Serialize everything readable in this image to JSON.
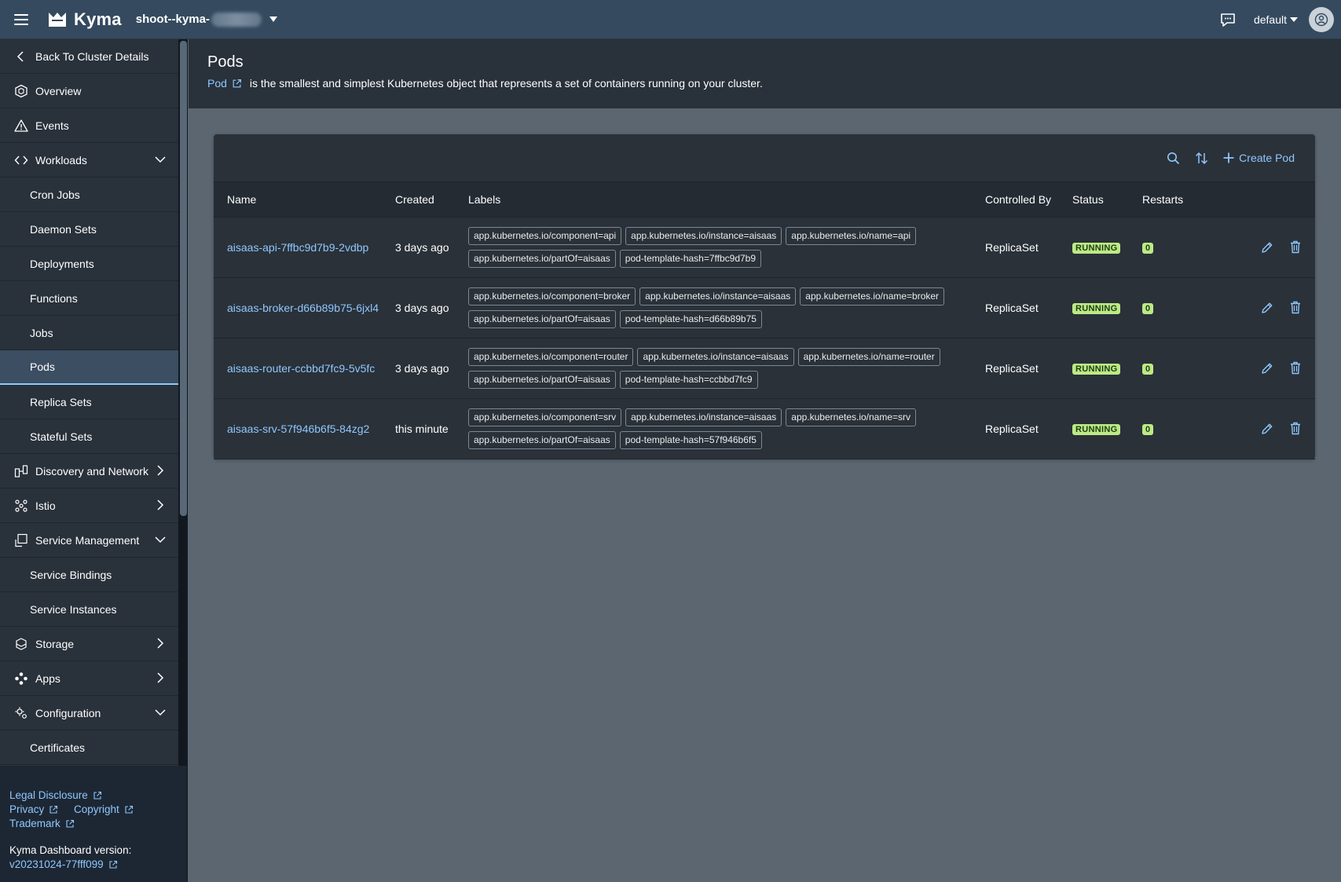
{
  "shell": {
    "app_name": "Kyma",
    "cluster_name": "shoot--kyma-",
    "namespace": "default"
  },
  "sidebar": {
    "back": "Back To Cluster Details",
    "items": [
      {
        "label": "Overview",
        "icon": "overview-icon"
      },
      {
        "label": "Events",
        "icon": "warning-icon"
      },
      {
        "label": "Workloads",
        "icon": "workloads-icon",
        "expanded": true
      },
      {
        "label": "Cron Jobs"
      },
      {
        "label": "Daemon Sets"
      },
      {
        "label": "Deployments"
      },
      {
        "label": "Functions"
      },
      {
        "label": "Jobs"
      },
      {
        "label": "Pods",
        "selected": true
      },
      {
        "label": "Replica Sets"
      },
      {
        "label": "Stateful Sets"
      },
      {
        "label": "Discovery and Network",
        "icon": "network-icon",
        "expanded": false
      },
      {
        "label": "Istio",
        "icon": "istio-icon",
        "expanded": false
      },
      {
        "label": "Service Management",
        "icon": "service-management-icon",
        "expanded": true
      },
      {
        "label": "Service Bindings"
      },
      {
        "label": "Service Instances"
      },
      {
        "label": "Storage",
        "icon": "storage-icon",
        "expanded": false
      },
      {
        "label": "Apps",
        "icon": "apps-icon",
        "expanded": false
      },
      {
        "label": "Configuration",
        "icon": "configuration-icon",
        "expanded": true
      },
      {
        "label": "Certificates"
      }
    ],
    "footer": {
      "legal": "Legal Disclosure",
      "privacy": "Privacy",
      "copyright": "Copyright",
      "trademark": "Trademark",
      "version_label": "Kyma Dashboard version:",
      "version": "v20231024-77fff099"
    }
  },
  "page": {
    "title": "Pods",
    "desc_link": "Pod",
    "description": "is the smallest and simplest Kubernetes object that represents a set of containers running on your cluster."
  },
  "toolbar": {
    "create_label": "Create Pod"
  },
  "table": {
    "columns": [
      "Name",
      "Created",
      "Labels",
      "Controlled By",
      "Status",
      "Restarts"
    ],
    "rows": [
      {
        "name": "aisaas-api-7ffbc9d7b9-2vdbp",
        "created": "3 days ago",
        "labels": [
          "app.kubernetes.io/component=api",
          "app.kubernetes.io/instance=aisaas",
          "app.kubernetes.io/name=api",
          "app.kubernetes.io/partOf=aisaas",
          "pod-template-hash=7ffbc9d7b9"
        ],
        "controlled_by": "ReplicaSet",
        "status": "RUNNING",
        "restarts": "0"
      },
      {
        "name": "aisaas-broker-d66b89b75-6jxl4",
        "created": "3 days ago",
        "labels": [
          "app.kubernetes.io/component=broker",
          "app.kubernetes.io/instance=aisaas",
          "app.kubernetes.io/name=broker",
          "app.kubernetes.io/partOf=aisaas",
          "pod-template-hash=d66b89b75"
        ],
        "controlled_by": "ReplicaSet",
        "status": "RUNNING",
        "restarts": "0"
      },
      {
        "name": "aisaas-router-ccbbd7fc9-5v5fc",
        "created": "3 days ago",
        "labels": [
          "app.kubernetes.io/component=router",
          "app.kubernetes.io/instance=aisaas",
          "app.kubernetes.io/name=router",
          "app.kubernetes.io/partOf=aisaas",
          "pod-template-hash=ccbbd7fc9"
        ],
        "controlled_by": "ReplicaSet",
        "status": "RUNNING",
        "restarts": "0"
      },
      {
        "name": "aisaas-srv-57f946b6f5-84zg2",
        "created": "this minute",
        "labels": [
          "app.kubernetes.io/component=srv",
          "app.kubernetes.io/instance=aisaas",
          "app.kubernetes.io/name=srv",
          "app.kubernetes.io/partOf=aisaas",
          "pod-template-hash=57f946b6f5"
        ],
        "controlled_by": "ReplicaSet",
        "status": "RUNNING",
        "restarts": "0"
      }
    ]
  },
  "colors": {
    "accent": "#8fc7ff",
    "shellbar": "#354a5f",
    "status_positive": "#bde986"
  }
}
